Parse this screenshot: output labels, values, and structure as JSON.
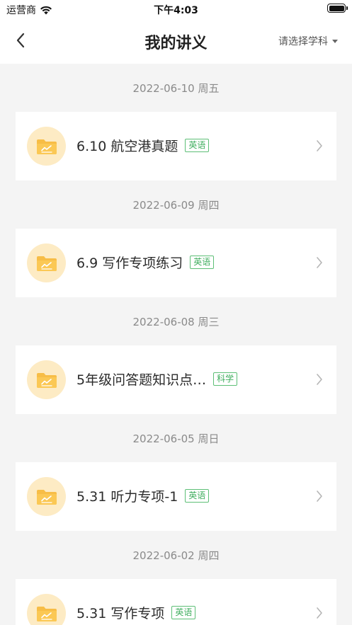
{
  "status_bar": {
    "carrier": "运营商",
    "time": "下午4:03"
  },
  "nav": {
    "title": "我的讲义",
    "subject_select": "请选择学科"
  },
  "colors": {
    "tag_green": "#3fae5e",
    "folder_bg": "#fdebc4",
    "folder_icon": "#f7bd46"
  },
  "groups": [
    {
      "date": "2022-06-10 周五",
      "title": "6.10 航空港真题",
      "tag": "英语"
    },
    {
      "date": "2022-06-09 周四",
      "title": "6.9 写作专项练习",
      "tag": "英语"
    },
    {
      "date": "2022-06-08 周三",
      "title": "5年级问答题知识点…",
      "tag": "科学"
    },
    {
      "date": "2022-06-05 周日",
      "title": "5.31 听力专项-1",
      "tag": "英语"
    },
    {
      "date": "2022-06-02 周四",
      "title": "5.31 写作专项",
      "tag": "英语"
    }
  ]
}
